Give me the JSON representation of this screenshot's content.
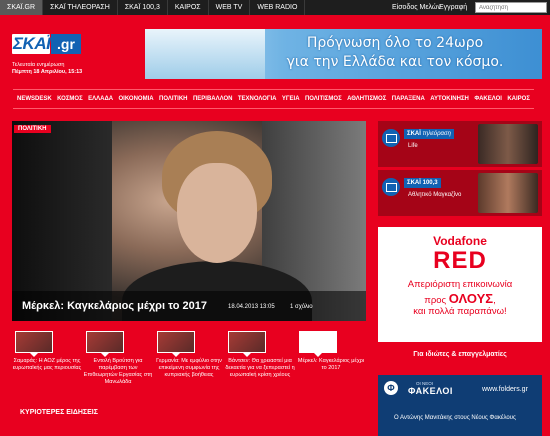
{
  "top_nav": {
    "items": [
      "ΣΚΑΪ.GR",
      "ΣΚΑΪ ΤΗΛΕΟΡΑΣΗ",
      "ΣΚΑΪ 100,3",
      "ΚΑΙΡΟΣ",
      "WEB TV",
      "WEB RADIO"
    ],
    "login": "Είσοδος Μελών",
    "register": "Εγγραφή",
    "search_placeholder": "Αναζήτηση"
  },
  "header": {
    "logo": "ΣΚΑΪ",
    "logo_suffix": ".gr",
    "update_label": "Τελευταία ενημέρωση",
    "update_time": "Πέμπτη 18 Απριλίου, 15:13",
    "banner_line1": "Πρόγνωση όλο το 24ωρο",
    "banner_line2": "για την Ελλάδα και τον κόσμο."
  },
  "main_nav": [
    "NEWSDESK",
    "ΚΟΣΜΟΣ",
    "ΕΛΛΑΔΑ",
    "ΟΙΚΟΝΟΜΙΑ",
    "ΠΟΛΙΤΙΚΗ",
    "ΠΕΡΙΒΑΛΛΟΝ",
    "ΤΕΧΝΟΛΟΓΙΑ",
    "ΥΓΕΙΑ",
    "ΠΟΛΙΤΙΣΜΟΣ",
    "ΑΘΛΗΤΙΣΜΟΣ",
    "ΠΑΡΑΞΕΝΑ",
    "ΑΥΤΟΚΙΝΗΣΗ",
    "ΦΑΚΕΛΟΙ",
    "ΚΑΙΡΟΣ"
  ],
  "hero": {
    "badge": "ΠΟΛΙΤΙΚΗ",
    "title": "Μέρκελ: Καγκελάριος μέχρι το 2017",
    "date": "18.04.2013 13:05",
    "comments": "1 σχόλιο"
  },
  "thumbs": [
    {
      "text": "Σαμαράς: Η ΑΟΖ μέρος της ευρωπαϊκής μας περιουσίας"
    },
    {
      "text": "Εντολή Βρούτση για παρέμβαση των Επιθεωρητών Εργασίας στη Μανωλάδα"
    },
    {
      "text": "Γερμανία: Με εμφύλιο στην επικείμενη συμφωνία της κυπριακής βοήθειας"
    },
    {
      "text": "Βάντσεν: Θα χρειαστεί μια δεκαετία για να ξεπεραστεί η ευρωπαϊκή κρίση χρέους"
    },
    {
      "text": "Μέρκελ: Καγκελάριος μέχρι το 2017"
    }
  ],
  "section_heading": "ΚΥΡΙΟΤΕΡΕΣ ΕΙΔΗΣΕΙΣ",
  "sidebar": {
    "tv_channel": "ΣΚΑΪ",
    "tv_sub": "τηλεόραση",
    "tv_show": "Life",
    "radio_channel": "ΣΚΑΪ",
    "radio_sub": "100,3",
    "radio_show": "Αθλητικό Μαγκαζίνο"
  },
  "ad": {
    "brand": "Vodafone",
    "title": "RED",
    "line1": "Απεριόριστη επικοινωνία",
    "line2_pre": "προς",
    "line2_big": "ΟΛΟΥΣ",
    "line2_post": ",",
    "line3": "και πολλά παραπάνω!",
    "footer": "Για ιδιώτες & επαγγελματίες"
  },
  "fakeloi": {
    "small": "ΟΙ ΝΕΟΙ",
    "name": "ΦΑΚΕΛΟΙ",
    "url": "www.folders.gr",
    "item": "Ο Αντώνης Μανιτάκης στους Νέους Φακέλους"
  }
}
